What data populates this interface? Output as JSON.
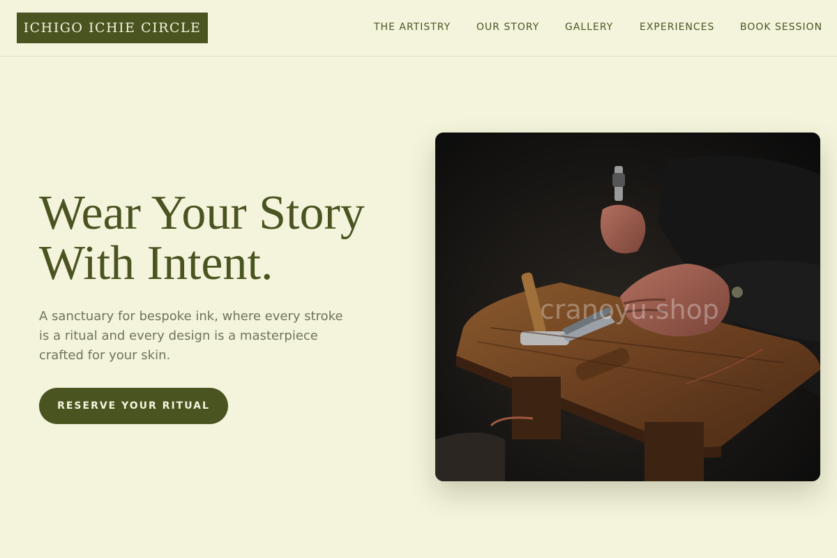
{
  "brand": {
    "logo_text": "ICHIGO ICHIE CIRCLE"
  },
  "nav": {
    "items": [
      {
        "label": "THE ARTISTRY"
      },
      {
        "label": "OUR STORY"
      },
      {
        "label": "GALLERY"
      },
      {
        "label": "EXPERIENCES"
      },
      {
        "label": "BOOK SESSION"
      }
    ]
  },
  "hero": {
    "title_line1": "Wear Your Story",
    "title_line2": "With Intent.",
    "description": "A sanctuary for bespoke ink, where every stroke is a ritual and every design is a masterpiece crafted for your skin.",
    "cta_label": "RESERVE YOUR RITUAL"
  },
  "image": {
    "subject": "Craftsman's hands working with hammer and tools on a worn wooden bench",
    "watermark": "cranoyu.shop"
  },
  "colors": {
    "background": "#f4f4dc",
    "brand_olive": "#4a5421",
    "muted_text": "#6f745a"
  }
}
